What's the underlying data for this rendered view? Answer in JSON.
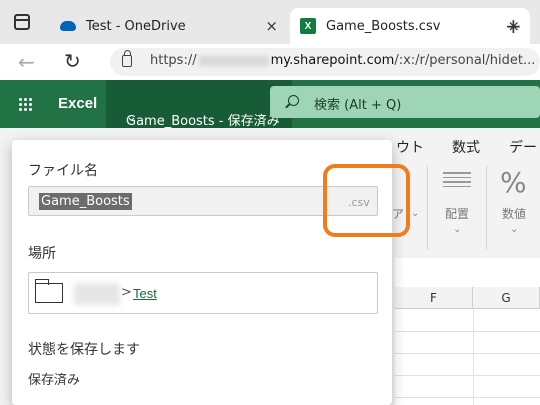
{
  "browser": {
    "tabs": [
      {
        "title": "Test - OneDrive",
        "close": "×"
      },
      {
        "title": "Game_Boosts.csv",
        "close": "×",
        "active": true
      }
    ],
    "new_tab": "+",
    "url": {
      "prefix": "https://",
      "host": "my.sharepoint.com",
      "path": "/:x:/r/personal/hidet..."
    }
  },
  "excel": {
    "app_name": "Excel",
    "doc_title": "Game_Boosts - 保存済み",
    "doc_chevron": "⌄",
    "search_placeholder": "検索 (Alt + Q)",
    "ribbon_tabs": [
      "ウト",
      "数式",
      "デー"
    ],
    "ribbon_groups": [
      {
        "label": "配置",
        "chevron": "⌄"
      },
      {
        "label": "数値",
        "chevron": "⌄"
      }
    ],
    "ribbon_partial_label": "ア",
    "number_symbol": "%",
    "columns": [
      "F",
      "G"
    ]
  },
  "rename_panel": {
    "file_name_label": "ファイル名",
    "file_name_value": "Game_Boosts",
    "extension": ".csv",
    "location_label": "場所",
    "location_separator": ">",
    "location_folder": "Test",
    "state_label": "状態を保存します",
    "state_value": "保存済み"
  },
  "colors": {
    "excel_green": "#217346",
    "highlight_orange": "#ef7d1b",
    "search_bg": "#9fd5b7"
  }
}
